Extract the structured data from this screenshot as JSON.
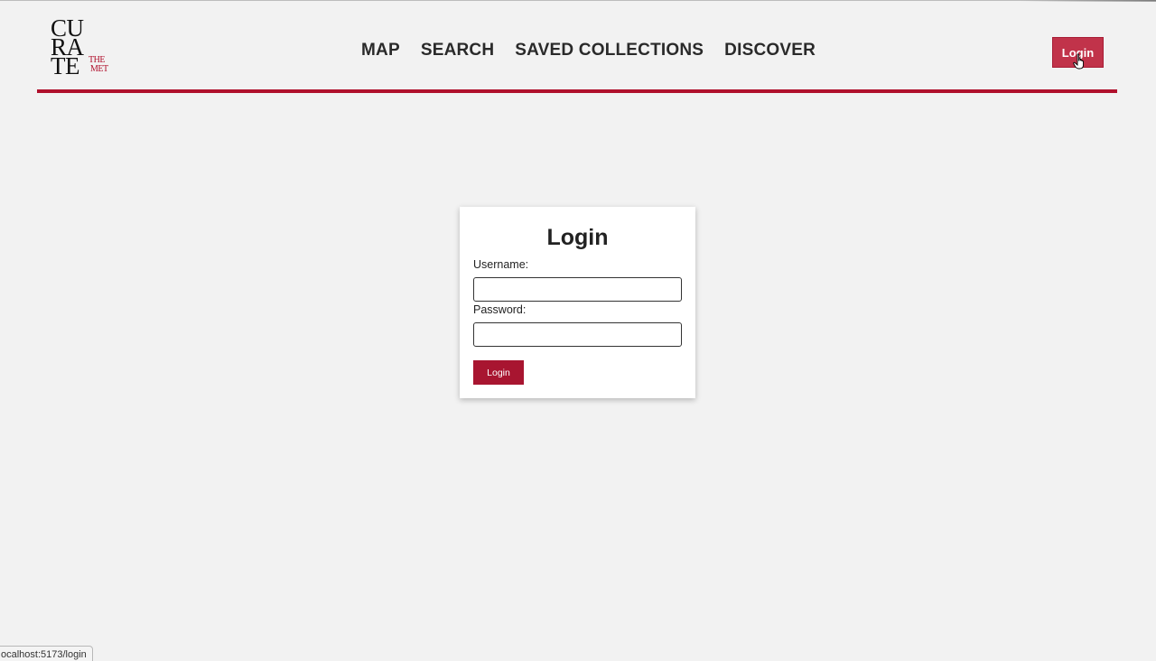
{
  "logo": {
    "row1": "CU",
    "row2": "RA",
    "row3": "TE",
    "sub1": "THE",
    "sub2": "MET",
    "accent_color": "#b0102c"
  },
  "nav": {
    "items": [
      {
        "label": "MAP"
      },
      {
        "label": "SEARCH"
      },
      {
        "label": "SAVED COLLECTIONS"
      },
      {
        "label": "DISCOVER"
      }
    ]
  },
  "header": {
    "login_label": "Login",
    "login_color": "#c1334a",
    "rule_color": "#b0102c",
    "cursor_icon": "hand-pointer-icon"
  },
  "login_form": {
    "title": "Login",
    "username_label": "Username:",
    "username_value": "",
    "password_label": "Password:",
    "password_value": "",
    "submit_label": "Login",
    "submit_color": "#a81530"
  },
  "status_bar": {
    "url": "ocalhost:5173/login"
  }
}
